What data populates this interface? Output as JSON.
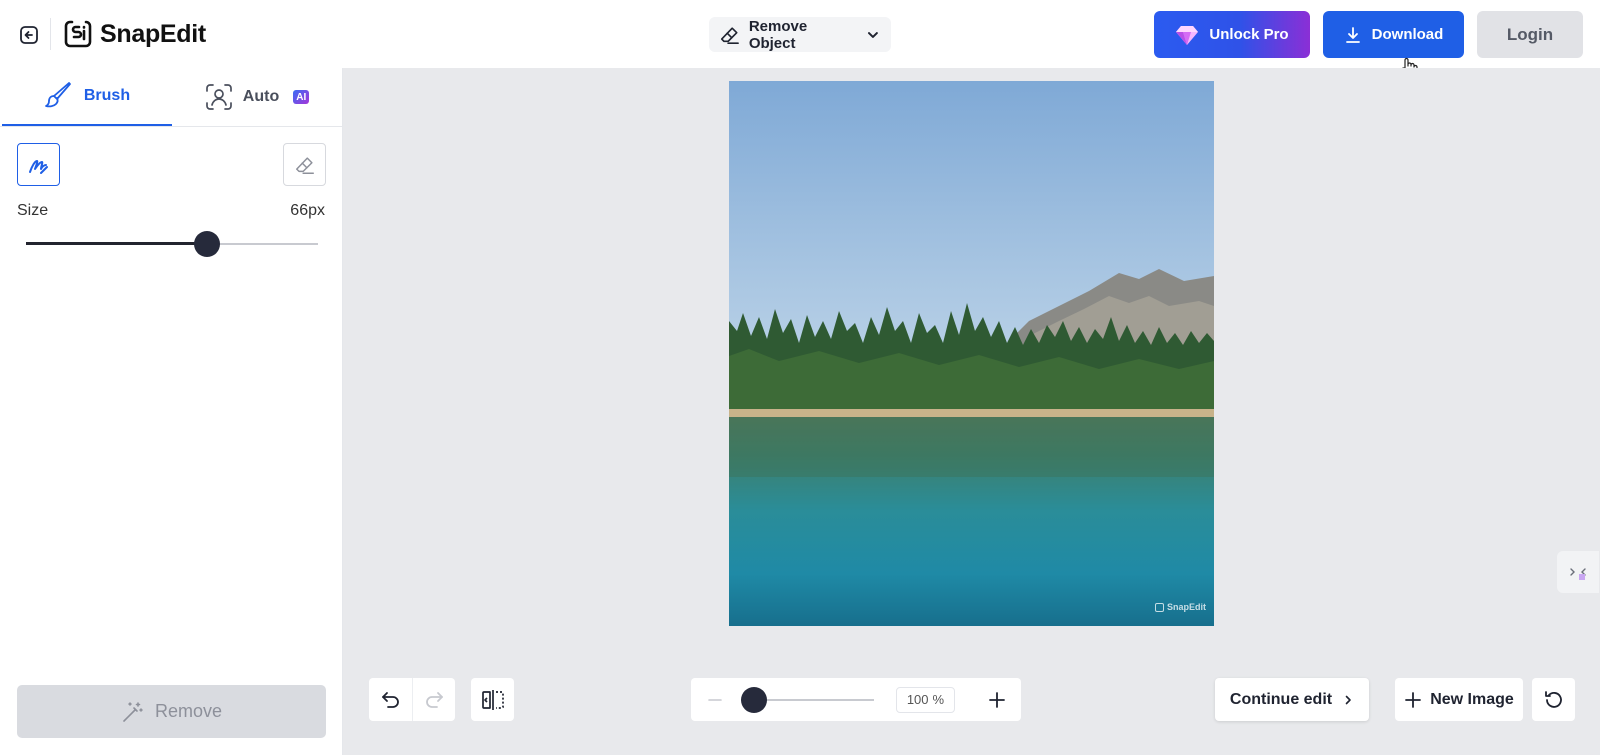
{
  "header": {
    "logo_text": "SnapEdit",
    "mode": "Remove Object",
    "unlock_label": "Unlock Pro",
    "download_label": "Download",
    "login_label": "Login"
  },
  "sidebar": {
    "tabs": [
      {
        "label": "Brush",
        "active": true
      },
      {
        "label": "Auto",
        "badge": "AI",
        "active": false
      }
    ],
    "size_label": "Size",
    "size_value": "66px",
    "size_level_percent": 62,
    "remove_label": "Remove"
  },
  "canvas": {
    "watermark": "SnapEdit",
    "zoom_value": "100",
    "zoom_unit": "%",
    "zoom_level_percent": 10,
    "continue_label": "Continue edit",
    "new_image_label": "New Image"
  },
  "colors": {
    "accent": "#1f5fe6",
    "canvas_bg": "#e8e9ec",
    "slider_thumb": "#262a3b"
  },
  "icons": [
    "back-icon",
    "logo-icon",
    "eraser-icon",
    "chevron-down-icon",
    "diamond-icon",
    "download-icon",
    "brush-icon",
    "face-scan-icon",
    "pen-icon",
    "magic-wand-icon",
    "undo-icon",
    "redo-icon",
    "compare-icon",
    "minus-icon",
    "plus-icon",
    "chevron-right-icon",
    "reset-icon",
    "collapse-icon",
    "hand-cursor-icon"
  ]
}
